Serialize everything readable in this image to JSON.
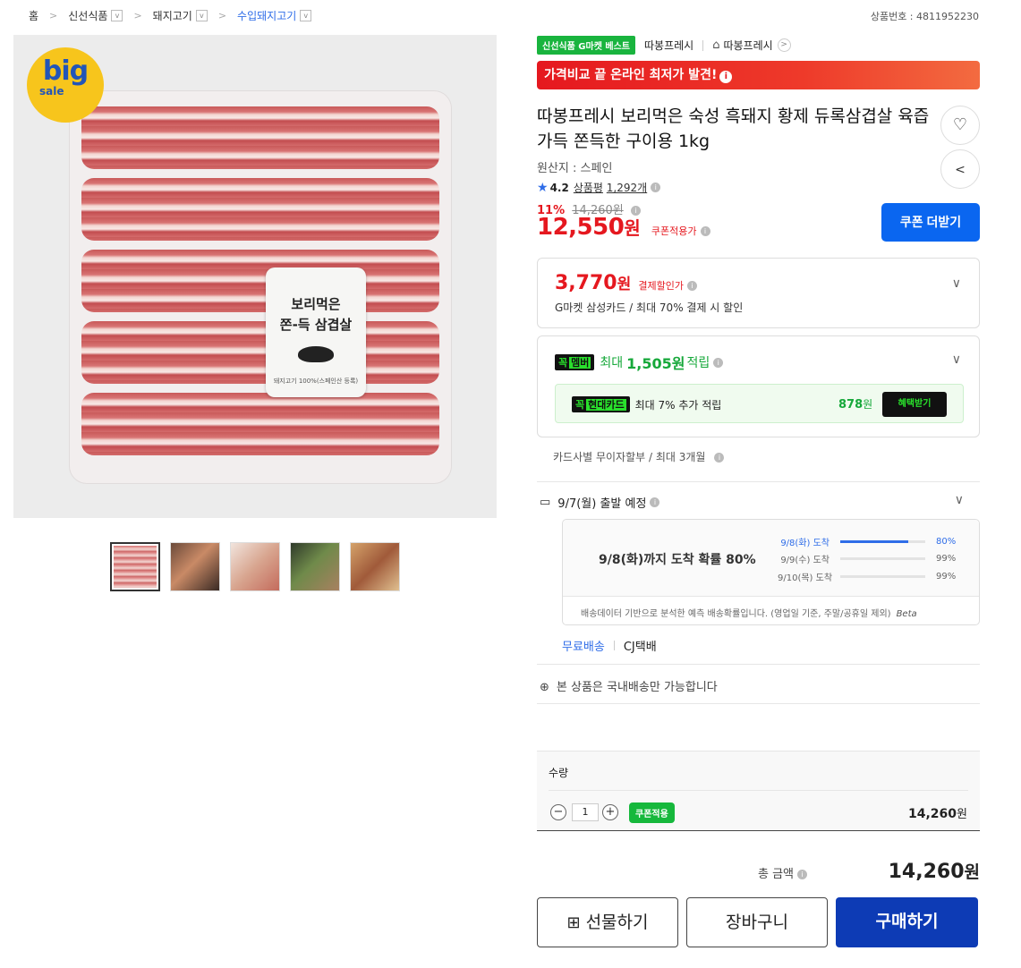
{
  "breadcrumb": {
    "home": "홈",
    "items": [
      "신선식품",
      "돼지고기",
      "수입돼지고기"
    ]
  },
  "product_number": "상품번호 : 4811952230",
  "image": {
    "badge_big": "big",
    "badge_sale": "sale",
    "label_line1": "보리먹은",
    "label_line2": "쫀-득 삼겹살",
    "label_line3": "돼지고기 100%(스페인산 등록)"
  },
  "tags": {
    "best_badge": "신선식품 G마켓 베스트",
    "seller": "따봉프레시",
    "shop_link": "따봉프레시"
  },
  "promo": {
    "text_pre": "가격비교 끝 ",
    "text_bold": "온라인 최저가 발견!",
    "info": "i"
  },
  "title": "따봉프레시 보리먹은 숙성 흑돼지 황제 듀록삼겹살 육즙가득 쫀득한 구이용 1kg",
  "origin": "원산지 : 스페인",
  "rating": {
    "score": "4.2",
    "review_label": "상품평",
    "review_count": "1,292개"
  },
  "price": {
    "discount_pct": "11%",
    "original": "14,260원",
    "sale_num": "12,550",
    "sale_unit": "원",
    "coupon_tag": "쿠폰적용가"
  },
  "coupon_button": "쿠폰 더받기",
  "card_pay": {
    "price_num": "3,770",
    "price_unit": "원",
    "label": "결제할인가",
    "desc": "G마켓 삼성카드 / 최대 70% 결제 시 할인"
  },
  "member": {
    "badge_a": "꼭",
    "badge_b": "멤버",
    "max_text": "최대",
    "amount": "1,505원",
    "accrue": "적립",
    "hyundai_badge_a": "꼭",
    "hyundai_badge_b": "현대카드",
    "hyundai_text": "최대 7% 추가 적립",
    "hyundai_pts": "878",
    "hyundai_unit": "원",
    "benefit_button": "혜택받기"
  },
  "installment": "카드사별 무이자할부 / 최대 3개월",
  "shipping": {
    "departure": "9/7(월) 출발 예정",
    "probability_headline": "9/8(화)까지 도착 확률 80%",
    "predictions": [
      {
        "date": "9/8(화) 도착",
        "pct": "80%",
        "value": 0.8
      },
      {
        "date": "9/9(수) 도착",
        "pct": "99%",
        "value": 0.99
      },
      {
        "date": "9/10(목) 도착",
        "pct": "99%",
        "value": 0.99
      }
    ],
    "note": "배송데이터 기반으로 분석한 예측 배송확률입니다. (영업일 기준, 주말/공휴일 제외)",
    "beta": "Beta",
    "free_shipping": "무료배송",
    "courier": "CJ택배",
    "domestic_only": "본 상품은 국내배송만 가능합니다"
  },
  "quantity": {
    "label": "수량",
    "value": "1",
    "coupon_applied": "쿠폰적용",
    "price_num": "14,260",
    "price_unit": "원"
  },
  "total": {
    "label": "총 금액",
    "value_num": "14,260",
    "value_unit": "원"
  },
  "actions": {
    "gift": "선물하기",
    "cart": "장바구니",
    "buy": "구매하기"
  },
  "colors": {
    "accent_red": "#e5181f",
    "accent_blue": "#0a66f0",
    "buy_blue": "#0d3bb5",
    "smile_green": "#16a83a"
  }
}
